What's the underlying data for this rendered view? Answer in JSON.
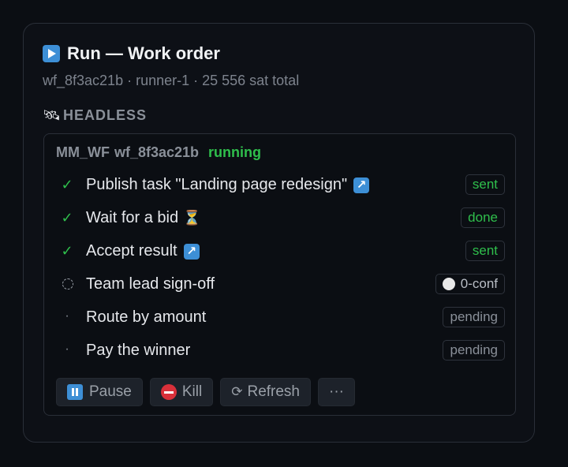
{
  "header": {
    "title": "Run — Work order",
    "subtitle": "wf_8f3ac21b · runner-1 · 25 556 sat total"
  },
  "mode": {
    "label": "HEADLESS",
    "icon": "satellite-icon"
  },
  "workflow": {
    "type": "MM_WF",
    "id": "wf_8f3ac21b",
    "status": "running",
    "status_color": "#2fbf4c"
  },
  "steps": [
    {
      "label": "Publish task \"Landing page redesign\"",
      "state": "done",
      "badge": "sent",
      "icon": "external-link-icon"
    },
    {
      "label": "Wait for a bid",
      "state": "done",
      "badge": "done",
      "icon": "hourglass-icon"
    },
    {
      "label": "Accept result",
      "state": "done",
      "badge": "sent",
      "icon": "external-link-icon"
    },
    {
      "label": "Team lead sign-off",
      "state": "running",
      "badge": "0-conf"
    },
    {
      "label": "Route by amount",
      "state": "pending",
      "badge": "pending"
    },
    {
      "label": "Pay the winner",
      "state": "pending",
      "badge": "pending"
    }
  ],
  "actions": {
    "pause": "Pause",
    "kill": "Kill",
    "refresh": "Refresh",
    "more": "···"
  },
  "glyphs": {
    "check": "✓",
    "pending_dot": "·",
    "external": "↗",
    "hourglass": "⏳",
    "refresh": "⟳"
  },
  "colors": {
    "accent_blue": "#3d8fd6",
    "success_green": "#2fbf4c",
    "danger_red": "#d9303a"
  }
}
